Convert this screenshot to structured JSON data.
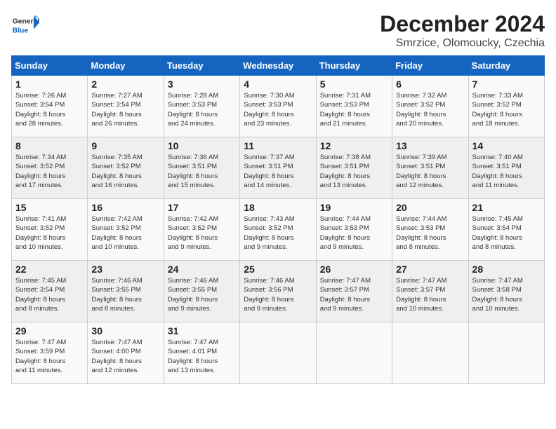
{
  "logo": {
    "general": "General",
    "blue": "Blue"
  },
  "calendar": {
    "title": "December 2024",
    "subtitle": "Smrzice, Olomoucky, Czechia"
  },
  "headers": [
    "Sunday",
    "Monday",
    "Tuesday",
    "Wednesday",
    "Thursday",
    "Friday",
    "Saturday"
  ],
  "weeks": [
    [
      {
        "day": "1",
        "info": "Sunrise: 7:26 AM\nSunset: 3:54 PM\nDaylight: 8 hours\nand 28 minutes."
      },
      {
        "day": "2",
        "info": "Sunrise: 7:27 AM\nSunset: 3:54 PM\nDaylight: 8 hours\nand 26 minutes."
      },
      {
        "day": "3",
        "info": "Sunrise: 7:28 AM\nSunset: 3:53 PM\nDaylight: 8 hours\nand 24 minutes."
      },
      {
        "day": "4",
        "info": "Sunrise: 7:30 AM\nSunset: 3:53 PM\nDaylight: 8 hours\nand 23 minutes."
      },
      {
        "day": "5",
        "info": "Sunrise: 7:31 AM\nSunset: 3:53 PM\nDaylight: 8 hours\nand 21 minutes."
      },
      {
        "day": "6",
        "info": "Sunrise: 7:32 AM\nSunset: 3:52 PM\nDaylight: 8 hours\nand 20 minutes."
      },
      {
        "day": "7",
        "info": "Sunrise: 7:33 AM\nSunset: 3:52 PM\nDaylight: 8 hours\nand 18 minutes."
      }
    ],
    [
      {
        "day": "8",
        "info": "Sunrise: 7:34 AM\nSunset: 3:52 PM\nDaylight: 8 hours\nand 17 minutes."
      },
      {
        "day": "9",
        "info": "Sunrise: 7:35 AM\nSunset: 3:52 PM\nDaylight: 8 hours\nand 16 minutes."
      },
      {
        "day": "10",
        "info": "Sunrise: 7:36 AM\nSunset: 3:51 PM\nDaylight: 8 hours\nand 15 minutes."
      },
      {
        "day": "11",
        "info": "Sunrise: 7:37 AM\nSunset: 3:51 PM\nDaylight: 8 hours\nand 14 minutes."
      },
      {
        "day": "12",
        "info": "Sunrise: 7:38 AM\nSunset: 3:51 PM\nDaylight: 8 hours\nand 13 minutes."
      },
      {
        "day": "13",
        "info": "Sunrise: 7:39 AM\nSunset: 3:51 PM\nDaylight: 8 hours\nand 12 minutes."
      },
      {
        "day": "14",
        "info": "Sunrise: 7:40 AM\nSunset: 3:51 PM\nDaylight: 8 hours\nand 11 minutes."
      }
    ],
    [
      {
        "day": "15",
        "info": "Sunrise: 7:41 AM\nSunset: 3:52 PM\nDaylight: 8 hours\nand 10 minutes."
      },
      {
        "day": "16",
        "info": "Sunrise: 7:42 AM\nSunset: 3:52 PM\nDaylight: 8 hours\nand 10 minutes."
      },
      {
        "day": "17",
        "info": "Sunrise: 7:42 AM\nSunset: 3:52 PM\nDaylight: 8 hours\nand 9 minutes."
      },
      {
        "day": "18",
        "info": "Sunrise: 7:43 AM\nSunset: 3:52 PM\nDaylight: 8 hours\nand 9 minutes."
      },
      {
        "day": "19",
        "info": "Sunrise: 7:44 AM\nSunset: 3:53 PM\nDaylight: 8 hours\nand 9 minutes."
      },
      {
        "day": "20",
        "info": "Sunrise: 7:44 AM\nSunset: 3:53 PM\nDaylight: 8 hours\nand 8 minutes."
      },
      {
        "day": "21",
        "info": "Sunrise: 7:45 AM\nSunset: 3:54 PM\nDaylight: 8 hours\nand 8 minutes."
      }
    ],
    [
      {
        "day": "22",
        "info": "Sunrise: 7:45 AM\nSunset: 3:54 PM\nDaylight: 8 hours\nand 8 minutes."
      },
      {
        "day": "23",
        "info": "Sunrise: 7:46 AM\nSunset: 3:55 PM\nDaylight: 8 hours\nand 8 minutes."
      },
      {
        "day": "24",
        "info": "Sunrise: 7:46 AM\nSunset: 3:55 PM\nDaylight: 8 hours\nand 9 minutes."
      },
      {
        "day": "25",
        "info": "Sunrise: 7:46 AM\nSunset: 3:56 PM\nDaylight: 8 hours\nand 9 minutes."
      },
      {
        "day": "26",
        "info": "Sunrise: 7:47 AM\nSunset: 3:57 PM\nDaylight: 8 hours\nand 9 minutes."
      },
      {
        "day": "27",
        "info": "Sunrise: 7:47 AM\nSunset: 3:57 PM\nDaylight: 8 hours\nand 10 minutes."
      },
      {
        "day": "28",
        "info": "Sunrise: 7:47 AM\nSunset: 3:58 PM\nDaylight: 8 hours\nand 10 minutes."
      }
    ],
    [
      {
        "day": "29",
        "info": "Sunrise: 7:47 AM\nSunset: 3:59 PM\nDaylight: 8 hours\nand 11 minutes."
      },
      {
        "day": "30",
        "info": "Sunrise: 7:47 AM\nSunset: 4:00 PM\nDaylight: 8 hours\nand 12 minutes."
      },
      {
        "day": "31",
        "info": "Sunrise: 7:47 AM\nSunset: 4:01 PM\nDaylight: 8 hours\nand 13 minutes."
      },
      null,
      null,
      null,
      null
    ]
  ]
}
